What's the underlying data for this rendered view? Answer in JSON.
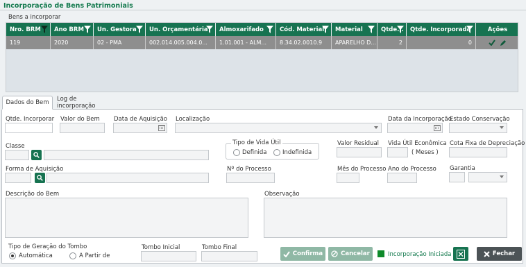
{
  "page": {
    "title": "Incorporação de Bens Patrimoniais"
  },
  "grid": {
    "label": "Bens a incorporar",
    "columns": [
      "Nro. BRM",
      "Ano BRM",
      "Un. Gestora",
      "Un. Orçamentária",
      "Almoxarifado",
      "Cód. Material",
      "Material",
      "Qtde...",
      "Qtde. Incorporada",
      "Ações"
    ],
    "row": [
      "119",
      "2020",
      "02 - PMA",
      "002.014.005.004.0...",
      "1.01.001 - ALM...",
      "8.34.02.0010.9",
      "APARELHO D...",
      "2",
      "0"
    ]
  },
  "tabs": {
    "active": "Dados do Bem",
    "inactive": "Log de incorporação"
  },
  "form": {
    "qtde_incorporar": "Qtde. Incorporar",
    "valor_bem": "Valor do Bem",
    "data_aquisicao": "Data de Aquisição",
    "localizacao": "Localização",
    "data_incorporacao": "Data da Incorporação",
    "estado_conservacao": "Estado Conservação",
    "tipo_vida_util": "Tipo de Vida Útil",
    "definida": "Definida",
    "indefinida": "Indefinida",
    "valor_residual": "Valor Residual",
    "vida_util_economica": "Vida Útil Econômica",
    "meses": "( Meses )",
    "cota_fixa": "Cota Fixa de Depreciação",
    "classe": "Classe",
    "forma_aquisicao": "Forma de Aquisição",
    "nro_processo": "Nº do Processo",
    "mes_processo": "Mês do Processo",
    "ano_processo": "Ano do Processo",
    "garantia": "Garantia",
    "descricao": "Descrição do Bem",
    "observacao": "Observação",
    "tipo_geracao": "Tipo de Geração do Tombo",
    "automatica": "Automática",
    "a_partir_de": "A Partir de",
    "tombo_inicial": "Tombo Inicial",
    "tombo_final": "Tombo Final"
  },
  "actions": {
    "confirma": "Confirma",
    "cancelar": "Cancelar",
    "status": "Incorporação Iniciada",
    "fechar": "Fechar"
  },
  "colors": {
    "brand": "#177351",
    "row_selected": "#8e8e8e",
    "status": "#0d8a2a"
  }
}
